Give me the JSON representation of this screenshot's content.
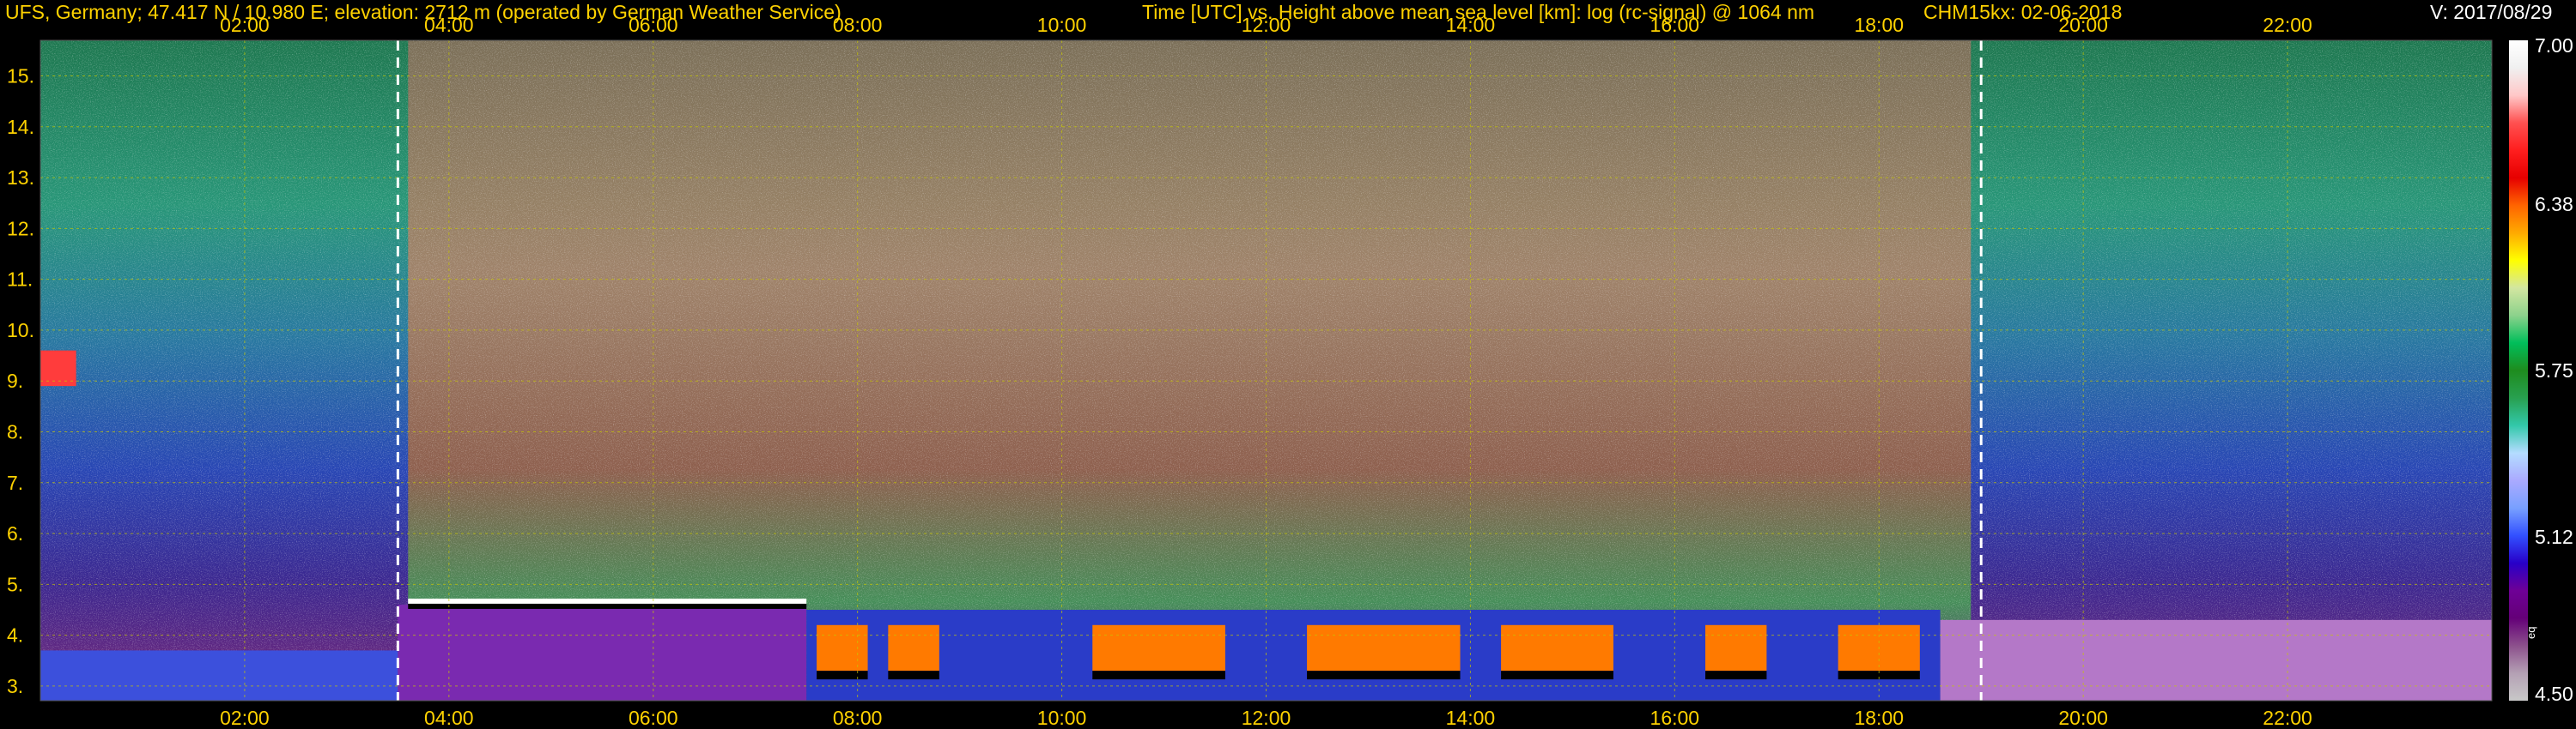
{
  "header": {
    "station": "UFS, Germany; 47.417 N / 10.980 E; elevation: 2712 m  (operated by German Weather Service)",
    "plot_title": "Time [UTC] vs. Height above mean sea level [km]: log (rc-signal) @ 1064 nm",
    "instrument_date": "CHM15kx: 02-06-2018",
    "version": "V: 2017/08/29"
  },
  "colors": {
    "background": "#000000",
    "axis_text": "#ffd200",
    "header_text": "#ffd200",
    "version_text": "#ffffff",
    "grid": "#c8c800",
    "markers": "#ffffff"
  },
  "chart_data": {
    "type": "heatmap",
    "title": "Time [UTC] vs. Height above mean sea level [km]: log (rc-signal) @ 1064 nm",
    "xlabel": "Time [UTC]",
    "ylabel": "Height above mean sea level [km]",
    "x_tick_labels": [
      "02:00",
      "04:00",
      "06:00",
      "08:00",
      "10:00",
      "12:00",
      "14:00",
      "16:00",
      "18:00",
      "20:00",
      "22:00"
    ],
    "x_tick_hours": [
      2,
      4,
      6,
      8,
      10,
      12,
      14,
      16,
      18,
      20,
      22
    ],
    "xlim_hours": [
      0,
      24
    ],
    "y_tick_labels": [
      "3.",
      "4.",
      "5.",
      "6.",
      "7.",
      "8.",
      "9.",
      "10.",
      "11.",
      "12.",
      "13.",
      "14.",
      "15."
    ],
    "y_tick_values": [
      3,
      4,
      5,
      6,
      7,
      8,
      9,
      10,
      11,
      12,
      13,
      14,
      15
    ],
    "ylim_km": [
      2.712,
      15.7
    ],
    "grid": true,
    "markers_hours": [
      3.5,
      19.0
    ],
    "colorbar": {
      "tick_labels": [
        "7.00",
        "6.38",
        "5.75",
        "5.12",
        "4.50"
      ],
      "tick_values": [
        7.0,
        6.38,
        5.75,
        5.12,
        4.5
      ],
      "range": [
        4.5,
        7.0
      ],
      "side_label": "eq",
      "colors": [
        "#c8c8c8",
        "#b4a0b4",
        "#8c508c",
        "#640078",
        "#6e0096",
        "#2800c8",
        "#3250ff",
        "#78a0ff",
        "#aaaaff",
        "#b4dcff",
        "#32c8aa",
        "#28a050",
        "#1e8c1e",
        "#00be5a",
        "#8cd28c",
        "#d2e6a0",
        "#ffff00",
        "#ffaa00",
        "#ff6400",
        "#e60000",
        "#ff1e1e",
        "#ff5050",
        "#ffc8c8",
        "#f0f0f0",
        "#ffffff"
      ]
    }
  }
}
